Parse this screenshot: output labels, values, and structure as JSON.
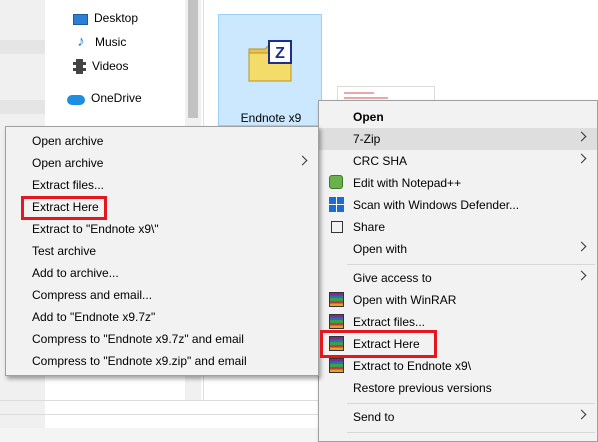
{
  "nav": {
    "items": [
      {
        "label": "Desktop",
        "icon": "desktop-icon"
      },
      {
        "label": "Music",
        "icon": "music-icon"
      },
      {
        "label": "Videos",
        "icon": "videos-icon"
      },
      {
        "label": "OneDrive",
        "icon": "onedrive-icon"
      }
    ]
  },
  "file": {
    "name": "Endnote x9",
    "icon": "winzip-archive-icon"
  },
  "context_menu": {
    "items": [
      {
        "label": "Open",
        "bold": true
      },
      {
        "label": "7-Zip",
        "submenu": true,
        "hovered": true
      },
      {
        "label": "CRC SHA",
        "submenu": true
      },
      {
        "label": "Edit with Notepad++",
        "icon": "notepadpp-icon"
      },
      {
        "label": "Scan with Windows Defender...",
        "icon": "windows-defender-icon"
      },
      {
        "label": "Share",
        "icon": "share-icon"
      },
      {
        "label": "Open with",
        "submenu": true
      },
      {
        "label": "Give access to",
        "submenu": true
      },
      {
        "label": "Open with WinRAR",
        "icon": "winrar-icon"
      },
      {
        "label": "Extract files...",
        "icon": "winrar-icon"
      },
      {
        "label": "Extract Here",
        "icon": "winrar-icon",
        "highlighted": true
      },
      {
        "label": "Extract to Endnote x9\\",
        "icon": "winrar-icon"
      },
      {
        "label": "Restore previous versions"
      },
      {
        "label": "Send to",
        "submenu": true
      }
    ]
  },
  "submenu_7zip": {
    "items": [
      {
        "label": "Open archive"
      },
      {
        "label": "Open archive",
        "submenu": true
      },
      {
        "label": "Extract files..."
      },
      {
        "label": "Extract Here",
        "highlighted": true
      },
      {
        "label": "Extract to \"Endnote x9\\\""
      },
      {
        "label": "Test archive"
      },
      {
        "label": "Add to archive..."
      },
      {
        "label": "Compress and email..."
      },
      {
        "label": "Add to \"Endnote x9.7z\""
      },
      {
        "label": "Compress to \"Endnote x9.7z\" and email"
      },
      {
        "label": "Compress to \"Endnote x9.zip\" and email"
      }
    ]
  },
  "colors": {
    "highlight_box": "#e4161e",
    "selection": "#cce8ff",
    "menu_bg": "#f2f2f2"
  }
}
